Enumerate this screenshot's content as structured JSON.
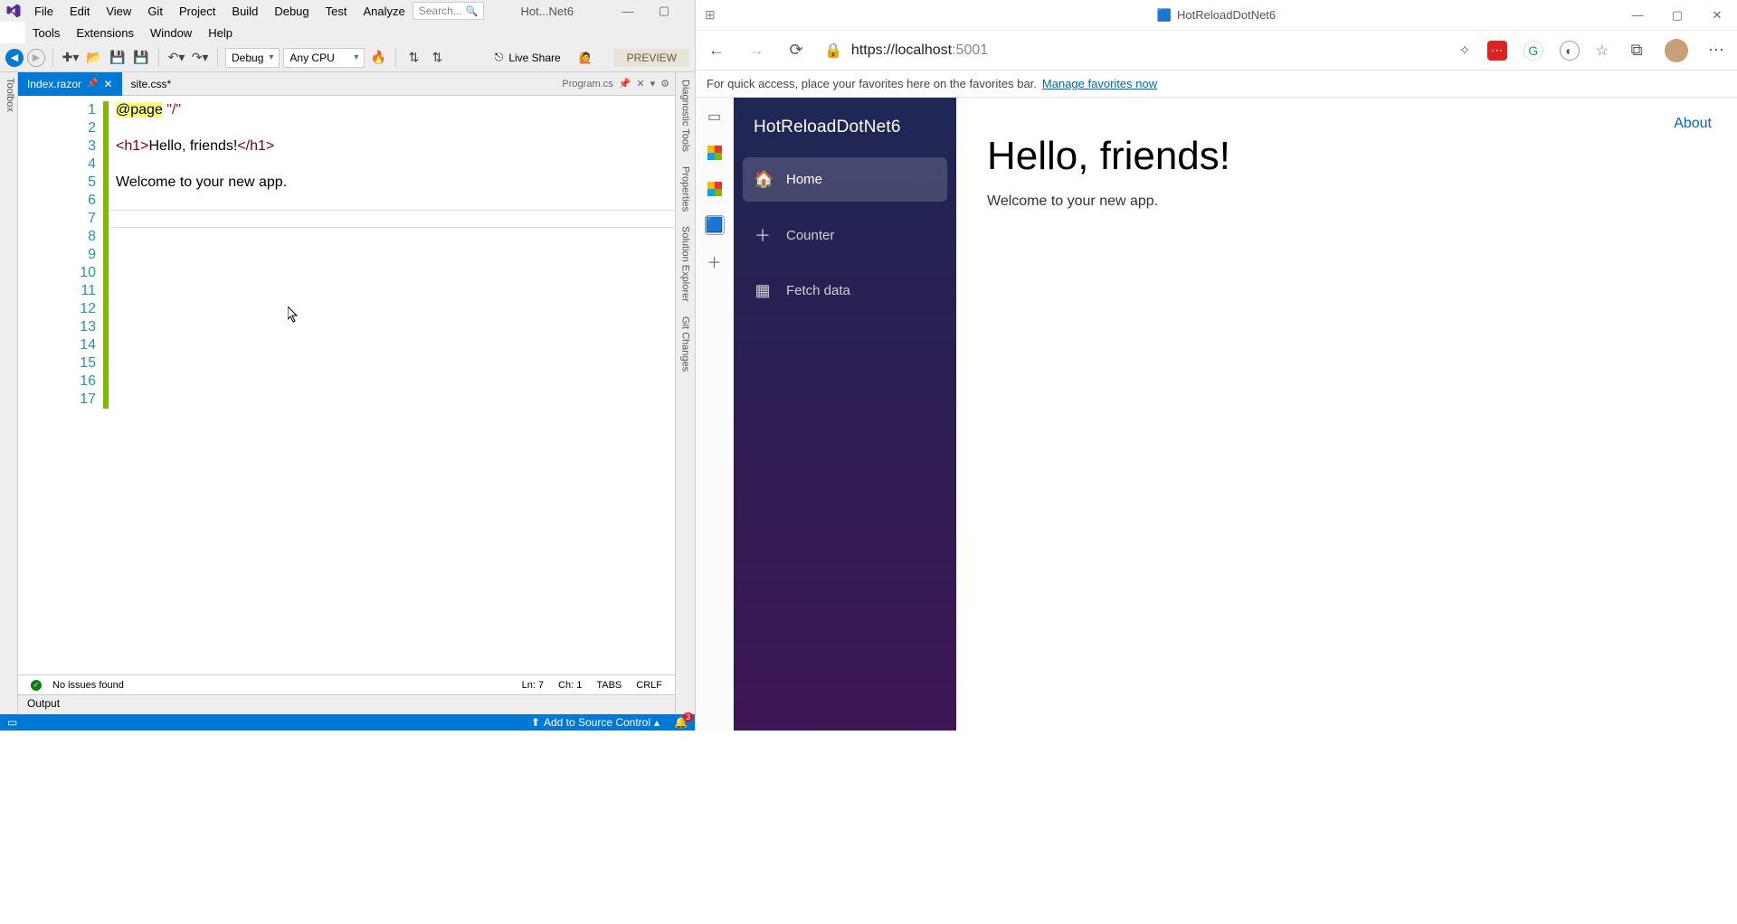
{
  "vs": {
    "menu1": [
      "File",
      "Edit",
      "View",
      "Git",
      "Project",
      "Build",
      "Debug",
      "Test",
      "Analyze"
    ],
    "menu2": [
      "Tools",
      "Extensions",
      "Window",
      "Help"
    ],
    "search_placeholder": "Search...",
    "solution": "Hot...Net6",
    "winbtns": {
      "min": "—",
      "max": "▢",
      "close": "✕"
    },
    "toolbar": {
      "config": "Debug",
      "platform": "Any CPU",
      "liveshare": "Live Share",
      "preview": "PREVIEW"
    },
    "toolbox": "Toolbox",
    "tabs": [
      {
        "name": "Index.razor",
        "pinned": true,
        "active": true
      },
      {
        "name": "site.css*",
        "pinned": false,
        "active": false
      },
      {
        "name": "Program.cs",
        "pinned": true,
        "active": false
      }
    ],
    "side_panels": [
      "Diagnostic Tools",
      "Properties",
      "Solution Explorer",
      "Git Changes"
    ],
    "code": {
      "line1_kw": "@page",
      "line1_str": " \"/\"",
      "line3_open": "<h1>",
      "line3_txt": "Hello, friends!",
      "line3_close": "</h1>",
      "line5": "Welcome to your new app."
    },
    "lines": [
      "1",
      "2",
      "3",
      "4",
      "5",
      "6",
      "7",
      "8",
      "9",
      "10",
      "11",
      "12",
      "13",
      "14",
      "15",
      "16",
      "17"
    ],
    "status": {
      "issues": "No issues found",
      "ln": "Ln: 7",
      "ch": "Ch: 1",
      "tabs": "TABS",
      "crlf": "CRLF"
    },
    "output": "Output",
    "bottom": {
      "add": "Add to Source Control",
      "bell": "3"
    }
  },
  "browser": {
    "title": "HotReloadDotNet6",
    "url_host": "https://localhost",
    "url_port": ":5001",
    "favbar": "For quick access, place your favorites here on the favorites bar.",
    "favlink": "Manage favorites now",
    "app": {
      "brand": "HotReloadDotNet6",
      "nav": [
        {
          "icon": "🏠",
          "label": "Home",
          "active": true
        },
        {
          "icon": "＋",
          "label": "Counter",
          "active": false
        },
        {
          "icon": "▦",
          "label": "Fetch data",
          "active": false
        }
      ],
      "about": "About",
      "h1": "Hello, friends!",
      "p": "Welcome to your new app."
    }
  }
}
